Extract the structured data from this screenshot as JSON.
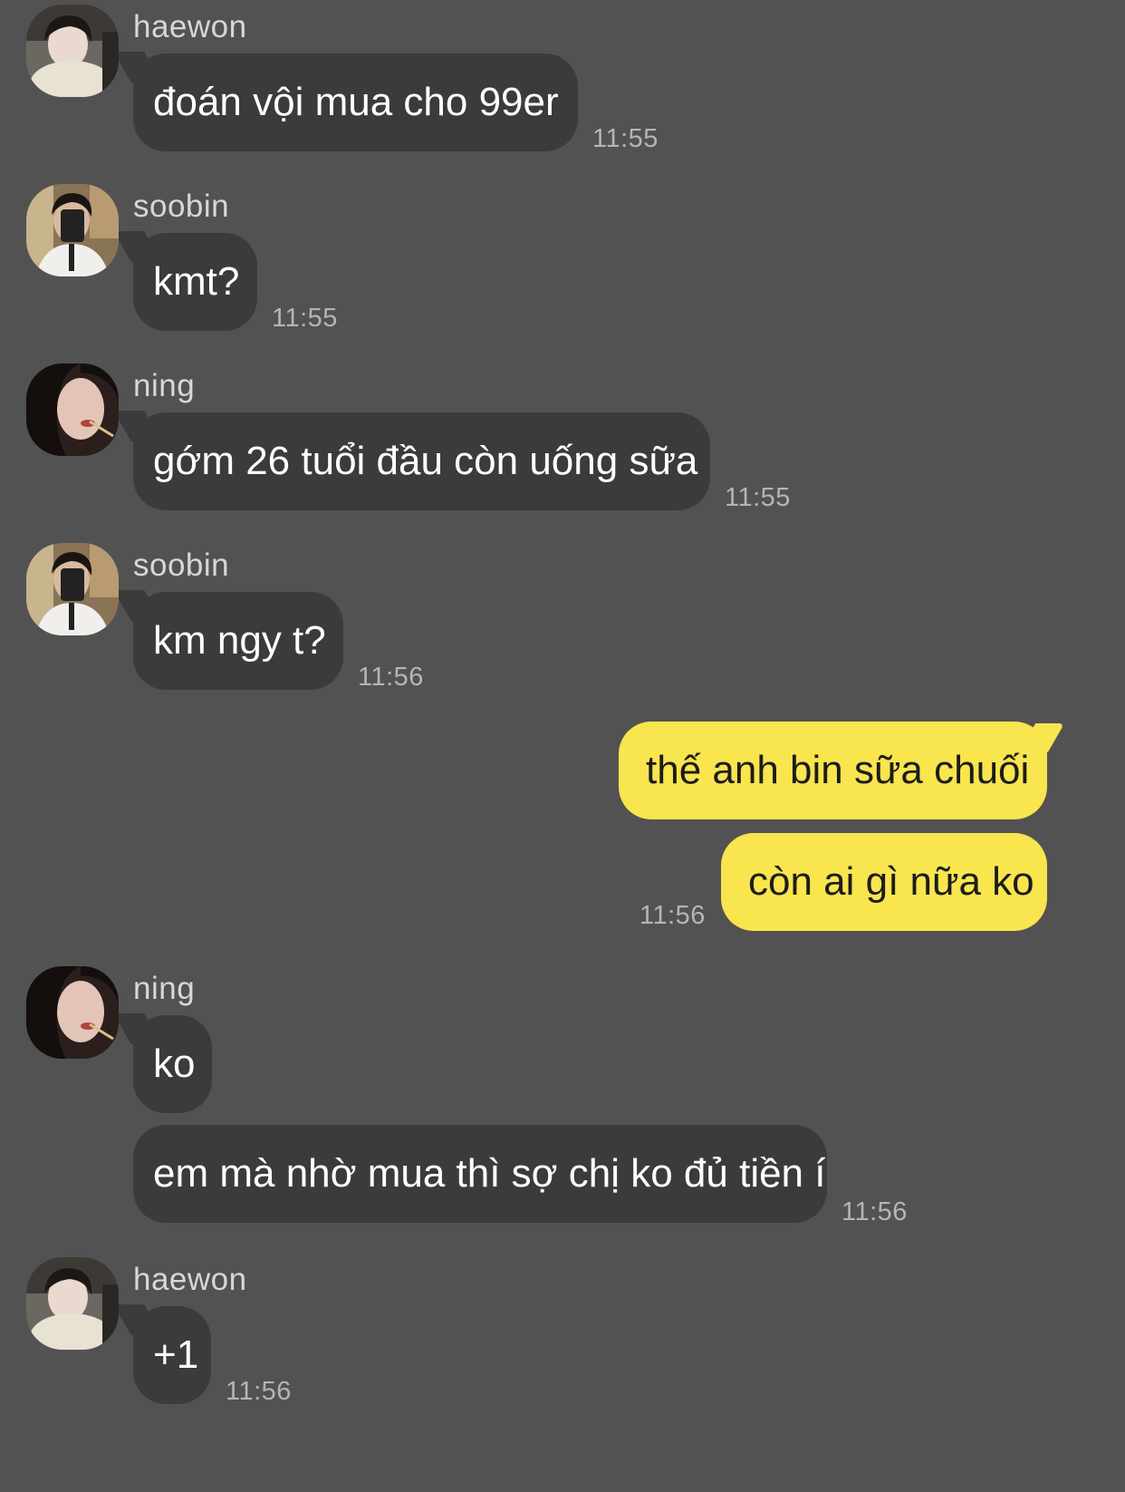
{
  "messages": [
    {
      "sender": "haewon",
      "text": "đoán vội mua cho 99er",
      "time": "11:55"
    },
    {
      "sender": "soobin",
      "text": "kmt?",
      "time": "11:55"
    },
    {
      "sender": "ning",
      "text": "gớm 26 tuổi đầu còn uống sữa",
      "time": "11:55"
    },
    {
      "sender": "soobin",
      "text": "km ngy t?",
      "time": "11:56"
    },
    {
      "sender": "me",
      "text": "thế anh bin sữa chuối",
      "time": ""
    },
    {
      "sender": "me",
      "text": "còn ai gì nữa ko",
      "time": "11:56"
    },
    {
      "sender": "ning",
      "text": "ko",
      "time": ""
    },
    {
      "sender": "ning",
      "text": "em mà nhờ mua thì sợ chị ko đủ tiền í",
      "time": "11:56"
    },
    {
      "sender": "haewon",
      "text": "+1",
      "time": "11:56"
    }
  ],
  "avatars": {
    "haewon": "haewon-avatar",
    "soobin": "soobin-avatar",
    "ning": "ning-avatar"
  },
  "colors": {
    "background": "#535253",
    "incoming_bubble": "#3c3b3c",
    "outgoing_bubble": "#f9e54d"
  }
}
